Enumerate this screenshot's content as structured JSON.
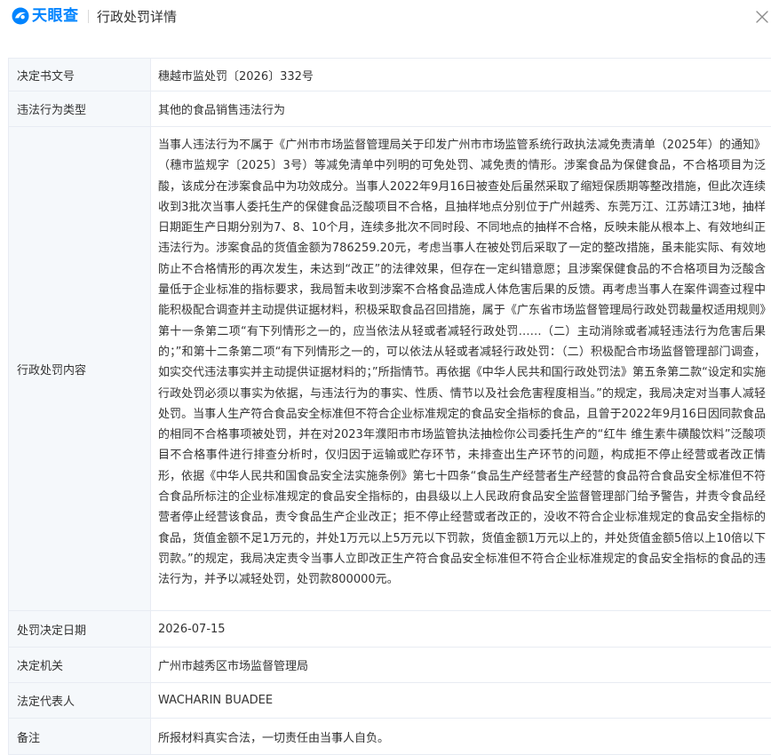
{
  "header": {
    "brand": "天眼查",
    "title": "行政处罚详情"
  },
  "colors": {
    "brand_blue": "#0084ff",
    "label_bg": "#f5f8fb",
    "border": "#e8ecf3",
    "text": "#333333"
  },
  "icons": {
    "logo": "tianyancha-logo-icon",
    "close": "close-icon"
  },
  "rows": [
    {
      "label": "决定书文号",
      "value": "穗越市监处罚〔2026〕332号"
    },
    {
      "label": "违法行为类型",
      "value": "其他的食品销售违法行为"
    },
    {
      "label": "行政处罚内容",
      "value": "当事人违法行为不属于《广州市市场监督管理局关于印发广州市市场监管系统行政执法减免责清单（2025年）的通知》（穗市监规字〔2025〕3号）等减免清单中列明的可免处罚、减免责的情形。涉案食品为保健食品，不合格项目为泛酸，该成分在涉案食品中为功效成分。当事人2022年9月16日被查处后虽然采取了缩短保质期等整改措施，但此次连续收到3批次当事人委托生产的保健食品泛酸项目不合格，且抽样地点分别位于广州越秀、东莞万江、江苏靖江3地，抽样日期距生产日期分别为7、8、10个月，连续多批次不同时段、不同地点的抽样不合格，反映未能从根本上、有效地纠正违法行为。涉案食品的货值金额为786259.20元，考虑当事人在被处罚后采取了一定的整改措施，虽未能实际、有效地防止不合格情形的再次发生，未达到“改正”的法律效果，但存在一定纠错意愿；且涉案保健食品的不合格项目为泛酸含量低于企业标准的指标要求，我局暂未收到涉案不合格食品造成人体危害后果的反馈。再考虑当事人在案件调查过程中能积极配合调查并主动提供证据材料，积极采取食品召回措施，属于《广东省市场监督管理局行政处罚裁量权适用规则》第十一条第二项“有下列情形之一的，应当依法从轻或者减轻行政处罚……（二）主动消除或者减轻违法行为危害后果的；”和第十二条第二项“有下列情形之一的，可以依法从轻或者减轻行政处罚：（二）积极配合市场监督管理部门调查，如实交代违法事实并主动提供证据材料的；”所指情节。再依据《中华人民共和国行政处罚法》第五条第二款“设定和实施行政处罚必须以事实为依据，与违法行为的事实、性质、情节以及社会危害程度相当。”的规定，我局决定对当事人减轻处罚。当事人生产符合食品安全标准但不符合企业标准规定的食品安全指标的食品，且曾于2022年9月16日因同款食品的相同不合格事项被处罚，并在对2023年濮阳市市场监管执法抽检你公司委托生产的“红牛 维生素牛磺酸饮料”泛酸项目不合格事件进行排查分析时，仅归因于运输或贮存环节，未排查出生产环节的问题，构成拒不停止经营或者改正情形，依据《中华人民共和国食品安全法实施条例》第七十四条“食品生产经营者生产经营的食品符合食品安全标准但不符合食品所标注的企业标准规定的食品安全指标的，由县级以上人民政府食品安全监督管理部门给予警告，并责令食品经营者停止经营该食品，责令食品生产企业改正；拒不停止经营或者改正的，没收不符合企业标准规定的食品安全指标的食品，货值金额不足1万元的，并处1万元以上5万元以下罚款，货值金额1万元以上的，并处货值金额5倍以上10倍以下罚款。”的规定，我局决定责令当事人立即改正生产符合食品安全标准但不符合企业标准规定的食品安全指标的食品的违法行为，并予以减轻处罚，处罚款800000元。"
    },
    {
      "label": "处罚决定日期",
      "value": "2026-07-15"
    },
    {
      "label": "决定机关",
      "value": "广州市越秀区市场监督管理局"
    },
    {
      "label": "法定代表人",
      "value": "WACHARIN BUADEE"
    },
    {
      "label": "备注",
      "value": "所报材料真实合法，一切责任由当事人自负。"
    }
  ]
}
